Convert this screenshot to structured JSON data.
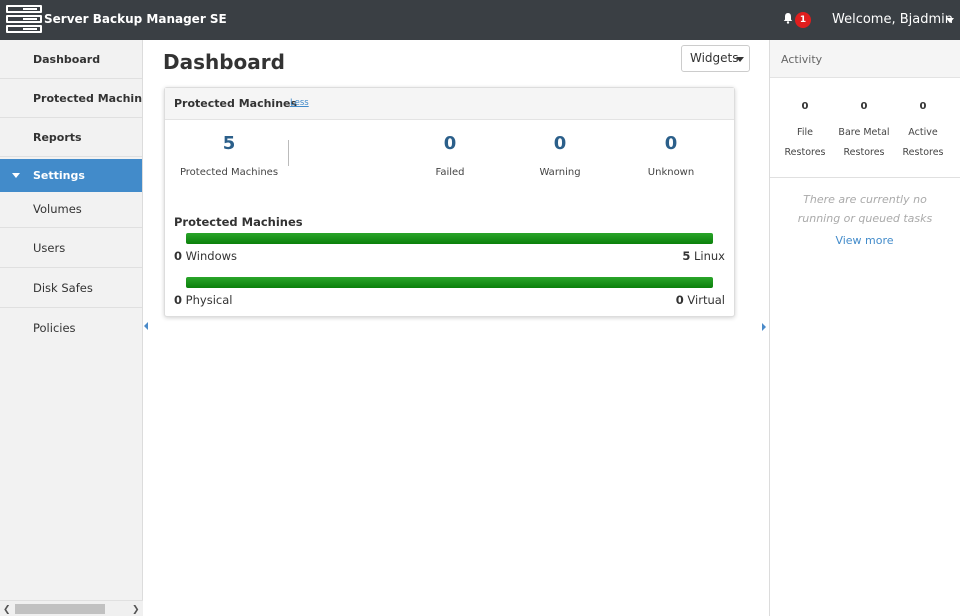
{
  "app": {
    "title": "Server Backup Manager SE",
    "notification_count": "1",
    "welcome": "Welcome, Bjadmin"
  },
  "sidebar": {
    "items": [
      {
        "label": "Dashboard"
      },
      {
        "label": "Protected Machines"
      },
      {
        "label": "Reports"
      },
      {
        "label": "Settings"
      }
    ],
    "subitems": [
      {
        "label": "Volumes"
      },
      {
        "label": "Users"
      },
      {
        "label": "Disk Safes"
      },
      {
        "label": "Policies"
      }
    ]
  },
  "main": {
    "title": "Dashboard",
    "widgets_label": "Widgets",
    "card": {
      "title": "Protected Machines",
      "toggle_label": "Less",
      "stats": [
        {
          "value": "5",
          "label": "Protected Machines"
        },
        {
          "value": "0",
          "label": "Failed"
        },
        {
          "value": "0",
          "label": "Warning"
        },
        {
          "value": "0",
          "label": "Unknown"
        }
      ],
      "section_title": "Protected Machines",
      "os_bar": {
        "left_count": "0",
        "left_label": "Windows",
        "right_count": "5",
        "right_label": "Linux",
        "fill_fraction": 1.0
      },
      "type_bar": {
        "left_count": "0",
        "left_label": "Physical",
        "right_count": "0",
        "right_label": "Virtual",
        "fill_fraction": 1.0
      }
    }
  },
  "activity": {
    "title": "Activity",
    "stats": [
      {
        "value": "0",
        "line1": "File",
        "line2": "Restores"
      },
      {
        "value": "0",
        "line1": "Bare Metal",
        "line2": "Restores"
      },
      {
        "value": "0",
        "line1": "Active",
        "line2": "Restores"
      }
    ],
    "empty_message": "There are currently no running or queued tasks",
    "view_more": "View more"
  },
  "colors": {
    "topbar": "#3a3f44",
    "accent": "#428bca",
    "badge": "#e01e1e",
    "bar_fill": "#139213"
  }
}
